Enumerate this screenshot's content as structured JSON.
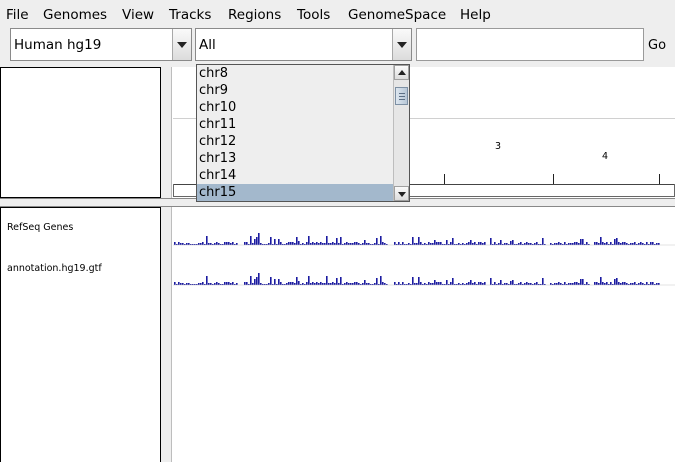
{
  "menu": {
    "file": "File",
    "genomes": "Genomes",
    "view": "View",
    "tracks": "Tracks",
    "regions": "Regions",
    "tools": "Tools",
    "genomespace": "GenomeSpace",
    "help": "Help"
  },
  "toolbar": {
    "genome_selected": "Human hg19",
    "chromosome_selected": "All",
    "locus_value": "",
    "go_label": "Go"
  },
  "ruler": {
    "labels": [
      "3",
      "4"
    ]
  },
  "chromosome_list": {
    "items": [
      "chr8",
      "chr9",
      "chr10",
      "chr11",
      "chr12",
      "chr13",
      "chr14",
      "chr15"
    ],
    "selected": "chr15"
  },
  "tracks": [
    {
      "name": "RefSeq Genes"
    },
    {
      "name": "annotation.hg19.gtf"
    }
  ],
  "colors": {
    "bar": "#1a1aa0",
    "selection": "#a3b8cc",
    "background": "#eeeeee"
  }
}
